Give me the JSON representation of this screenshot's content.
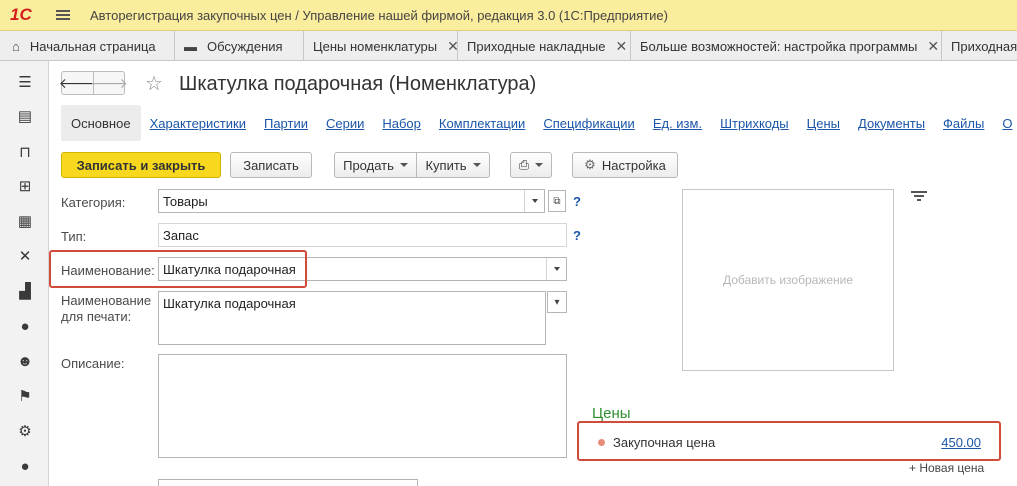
{
  "app": {
    "logo": "1С",
    "title": "Авторегистрация закупочных цен / Управление нашей фирмой, редакция 3.0  (1С:Предприятие)"
  },
  "tabs": [
    {
      "label": "Начальная страница",
      "closable": false,
      "icon": "home-icon"
    },
    {
      "label": "Обсуждения",
      "closable": false,
      "icon": "chat-icon"
    },
    {
      "label": "Цены номенклатуры",
      "closable": true
    },
    {
      "label": "Приходные накладные",
      "closable": true
    },
    {
      "label": "Больше возможностей: настройка программы",
      "closable": true
    },
    {
      "label": "Приходная",
      "closable": false
    }
  ],
  "sidebar_icons": [
    "menu-icon",
    "contacts-icon",
    "basket-icon",
    "cart-icon",
    "grid-icon",
    "tools-icon",
    "factory-icon",
    "ruble-icon",
    "people-icon",
    "flag-icon",
    "gear-icon",
    "help-icon"
  ],
  "form": {
    "title": "Шкатулка подарочная (Номенклатура)",
    "nav_links": [
      "Основное",
      "Характеристики",
      "Партии",
      "Серии",
      "Набор",
      "Комплектации",
      "Спецификации",
      "Ед. изм.",
      "Штрихкоды",
      "Цены",
      "Документы",
      "Файлы",
      "О"
    ],
    "toolbar": {
      "save_close": "Записать и закрыть",
      "save": "Записать",
      "sell": "Продать",
      "buy": "Купить",
      "settings": "Настройка"
    },
    "fields": {
      "category_label": "Категория:",
      "category_value": "Товары",
      "type_label": "Тип:",
      "type_value": "Запас",
      "name_label": "Наименование:",
      "name_value": "Шкатулка подарочная",
      "print_name_label_1": "Наименование",
      "print_name_label_2": "для печати:",
      "print_name_value": "Шкатулка подарочная",
      "description_label": "Описание:",
      "help": "?"
    },
    "image_placeholder": "Добавить изображение",
    "prices": {
      "title": "Цены",
      "items": [
        {
          "name": "Закупочная цена",
          "value": "450.00"
        }
      ],
      "new_price": "+ Новая цена"
    }
  },
  "colors": {
    "titlebar": "#fbed9e",
    "primary_button": "#f7d81f",
    "link": "#1b56a8",
    "highlight": "#d04b3a",
    "prices_title": "#2f8f2f"
  }
}
